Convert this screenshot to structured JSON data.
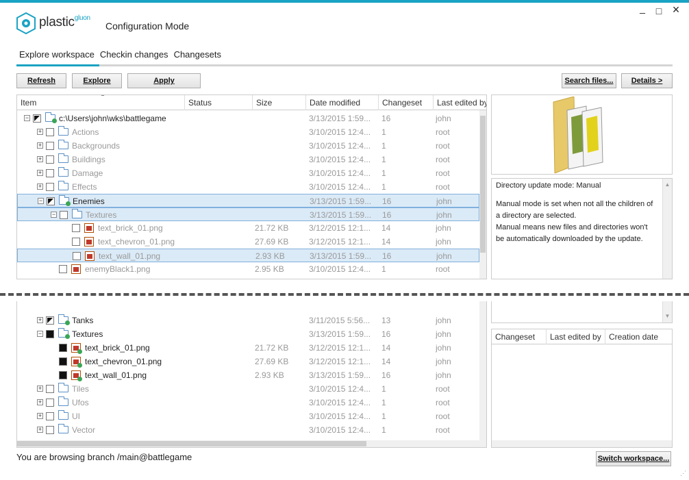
{
  "app": {
    "brand": "plastic",
    "brand_sup": "gluon",
    "mode": "Configuration Mode"
  },
  "window": {
    "minimize": "_",
    "maximize": "□",
    "close": "×"
  },
  "tabs": [
    "Explore workspace",
    "Checkin changes",
    "Changesets"
  ],
  "toolbar": {
    "refresh": "Refresh",
    "explore": "Explore",
    "apply": "Apply",
    "search": "Search files...",
    "details": "Details >"
  },
  "columns": [
    "Item",
    "Status",
    "Size",
    "Date modified",
    "Changeset",
    "Last edited by"
  ],
  "sort_indicator": "▲",
  "rows_top": [
    {
      "name": "c:\\Users\\john\\wks\\battlegame",
      "size": "",
      "date": "3/13/2015 1:59...",
      "cs": "16",
      "by": "john"
    },
    {
      "name": "Actions",
      "size": "",
      "date": "3/10/2015 12:4...",
      "cs": "1",
      "by": "root"
    },
    {
      "name": "Backgrounds",
      "size": "",
      "date": "3/10/2015 12:4...",
      "cs": "1",
      "by": "root"
    },
    {
      "name": "Buildings",
      "size": "",
      "date": "3/10/2015 12:4...",
      "cs": "1",
      "by": "root"
    },
    {
      "name": "Damage",
      "size": "",
      "date": "3/10/2015 12:4...",
      "cs": "1",
      "by": "root"
    },
    {
      "name": "Effects",
      "size": "",
      "date": "3/10/2015 12:4...",
      "cs": "1",
      "by": "root"
    },
    {
      "name": "Enemies",
      "size": "",
      "date": "3/13/2015 1:59...",
      "cs": "16",
      "by": "john"
    },
    {
      "name": "Textures",
      "size": "",
      "date": "3/13/2015 1:59...",
      "cs": "16",
      "by": "john"
    },
    {
      "name": "text_brick_01.png",
      "size": "21.72 KB",
      "date": "3/12/2015 12:1...",
      "cs": "14",
      "by": "john"
    },
    {
      "name": "text_chevron_01.png",
      "size": "27.69 KB",
      "date": "3/12/2015 12:1...",
      "cs": "14",
      "by": "john"
    },
    {
      "name": "text_wall_01.png",
      "size": "2.93 KB",
      "date": "3/13/2015 1:59...",
      "cs": "16",
      "by": "john"
    },
    {
      "name": "enemyBlack1.png",
      "size": "2.95 KB",
      "date": "3/10/2015 12:4...",
      "cs": "1",
      "by": "root"
    }
  ],
  "rows_bottom": [
    {
      "name": "Tanks",
      "size": "",
      "date": "3/11/2015 5:56...",
      "cs": "13",
      "by": "john"
    },
    {
      "name": "Textures",
      "size": "",
      "date": "3/13/2015 1:59...",
      "cs": "16",
      "by": "john"
    },
    {
      "name": "text_brick_01.png",
      "size": "21.72 KB",
      "date": "3/12/2015 12:1...",
      "cs": "14",
      "by": "john"
    },
    {
      "name": "text_chevron_01.png",
      "size": "27.69 KB",
      "date": "3/12/2015 12:1...",
      "cs": "14",
      "by": "john"
    },
    {
      "name": "text_wall_01.png",
      "size": "2.93 KB",
      "date": "3/13/2015 1:59...",
      "cs": "16",
      "by": "john"
    },
    {
      "name": "Tiles",
      "size": "",
      "date": "3/10/2015 12:4...",
      "cs": "1",
      "by": "root"
    },
    {
      "name": "Ufos",
      "size": "",
      "date": "3/10/2015 12:4...",
      "cs": "1",
      "by": "root"
    },
    {
      "name": "UI",
      "size": "",
      "date": "3/10/2015 12:4...",
      "cs": "1",
      "by": "root"
    },
    {
      "name": "Vector",
      "size": "",
      "date": "3/10/2015 12:4...",
      "cs": "1",
      "by": "root"
    }
  ],
  "details": {
    "line1": "Directory update mode: Manual",
    "line2": "Manual mode is set when not all the children of",
    "line3": "a directory are selected.",
    "line4": "Manual means new files and directories won't",
    "line5": "be automatically downloaded by the update."
  },
  "history_columns": [
    "Changeset",
    "Last edited by",
    "Creation date"
  ],
  "status": {
    "branch_text": "You are browsing branch /main@battlegame",
    "switch": "Switch workspace..."
  },
  "colors": {
    "accent": "#1aa3c4",
    "selection": "#dbeaf7"
  }
}
